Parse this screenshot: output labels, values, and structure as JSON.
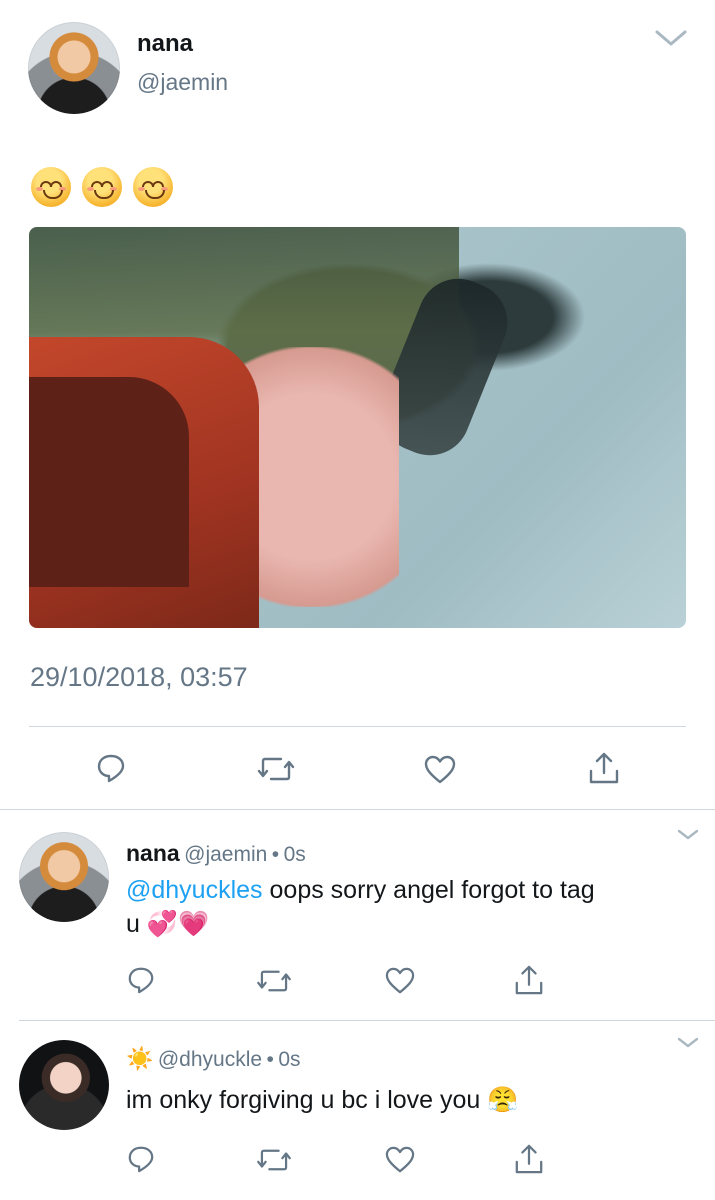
{
  "main_tweet": {
    "display_name": "nana",
    "handle": "@jaemin",
    "text": "😊😊😊",
    "timestamp": "29/10/2018, 03:57"
  },
  "replies": [
    {
      "display_name": "nana",
      "handle": "@jaemin",
      "dot": "•",
      "time": "0s",
      "mention": "@dhyuckles",
      "text_line1": " oops sorry angel forgot to tag",
      "text_line2": "u 💞💗"
    },
    {
      "display_name": "☀️",
      "handle": "@dhyuckle",
      "dot": "•",
      "time": "0s",
      "text": "im onky forgiving u bc i love you 😤"
    }
  ],
  "icons": {
    "reply": "reply-icon",
    "retweet": "retweet-icon",
    "like": "heart-icon",
    "share": "share-icon",
    "caret": "chevron-down-icon"
  },
  "colors": {
    "mention": "#1da1f2",
    "secondary_text": "#657786",
    "separator": "#cfd7dd"
  }
}
